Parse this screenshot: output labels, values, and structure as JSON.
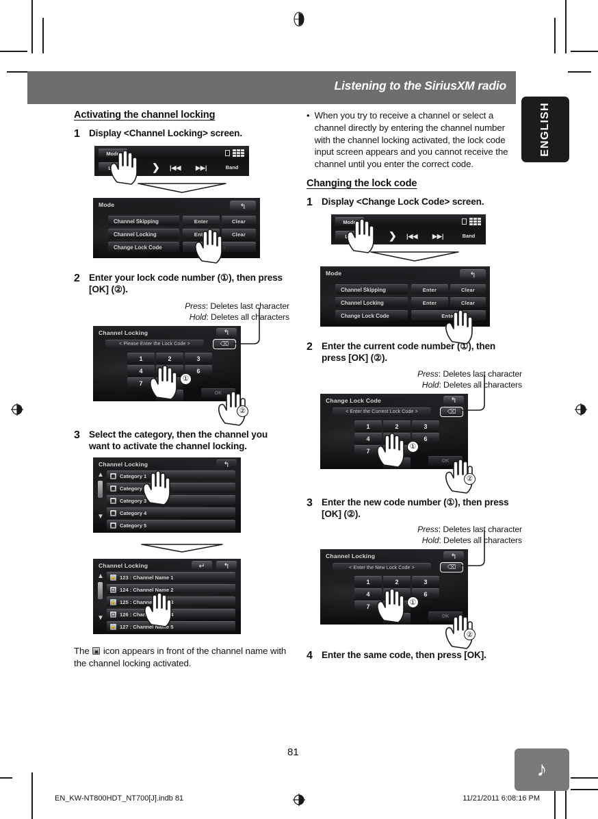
{
  "header": {
    "title": "Listening to the SiriusXM radio",
    "lang_tab": "ENGLISH",
    "note_icon": "music-note-icon"
  },
  "page": {
    "number": "81",
    "footer_left": "EN_KW-NT800HDT_NT700[J].indb   81",
    "footer_right": "11/21/2011   6:08:16 PM"
  },
  "left_column": {
    "section_heading": "Activating the channel locking",
    "step1": {
      "num": "1",
      "text": "Display <Channel Locking> screen."
    },
    "toolbar_screen": {
      "mode": "Mode",
      "list": "List",
      "next": "❯",
      "prev_track": "|◀◀",
      "next_track": "▶▶|",
      "band": "Band"
    },
    "mode_screen": {
      "title": "Mode",
      "rows": [
        {
          "label": "Channel Skipping",
          "enter": "Enter",
          "clear": "Clear"
        },
        {
          "label": "Channel Locking",
          "enter": "Enter",
          "clear": "Clear"
        },
        {
          "label": "Change Lock Code",
          "enter": "Enter",
          "clear": ""
        }
      ],
      "back_icon": "back-arrow-icon"
    },
    "step2": {
      "num": "2",
      "text_before": "Enter your lock code number (",
      "marker1": "①",
      "text_mid": "), then press [OK] (",
      "marker2": "②",
      "text_after": ")."
    },
    "press_label": "Press",
    "press_desc": ": Deletes last character",
    "hold_label": "Hold",
    "hold_desc": ": Deletes all characters",
    "keypad_screen": {
      "title": "Channel Locking",
      "prompt": "< Please Enter the Lock Code >",
      "keys": [
        "1",
        "2",
        "3",
        "4",
        "5",
        "6",
        "7",
        "8",
        "0"
      ],
      "ok": "OK",
      "delete_icon": "backspace-icon",
      "back_icon": "back-arrow-icon",
      "marker1": "①",
      "marker2": "②"
    },
    "step3": {
      "num": "3",
      "text": "Select the category, then the channel you want to activate the channel locking."
    },
    "category_screen": {
      "title": "Channel Locking",
      "rows": [
        "Category 1",
        "Category 2",
        "Category 3",
        "Category 4",
        "Category 5"
      ],
      "up_icon": "chevron-up-icon",
      "down_icon": "chevron-down-icon",
      "back_icon": "back-arrow-icon"
    },
    "channel_screen": {
      "title": "Channel Locking",
      "rows": [
        {
          "text": "123 : Channel Name 1",
          "icon": "lock-icon"
        },
        {
          "text": "124 : Channel Name 2",
          "icon": "unlock-icon"
        },
        {
          "text": "125 : Channel Name 3",
          "icon": "lock-icon"
        },
        {
          "text": "126 : Channel Name 4",
          "icon": "unlock-icon"
        },
        {
          "text": "127 : Channel Name 5",
          "icon": "lock-icon"
        }
      ],
      "up_icon": "chevron-up-icon",
      "down_icon": "chevron-down-icon",
      "return_icon": "return-arrow-icon",
      "back_icon": "back-arrow-icon"
    },
    "note_before": "The ",
    "note_after": " icon appears in front of the channel name with the channel locking activated."
  },
  "right_column": {
    "bullet": "When you try to receive a channel or select a channel directly by entering the channel number with the channel locking activated, the lock code input screen appears and you cannot receive the channel until you enter the correct code.",
    "section_heading": "Changing the lock code",
    "step1": {
      "num": "1",
      "text": "Display <Change Lock Code> screen."
    },
    "toolbar_screen": {
      "mode": "Mode",
      "list": "List",
      "next": "❯",
      "prev_track": "|◀◀",
      "next_track": "▶▶|",
      "band": "Band"
    },
    "mode_screen": {
      "title": "Mode",
      "rows": [
        {
          "label": "Channel Skipping",
          "enter": "Enter",
          "clear": "Clear"
        },
        {
          "label": "Channel Locking",
          "enter": "Enter",
          "clear": "Clear"
        },
        {
          "label": "Change Lock Code",
          "enter": "Enter",
          "clear": ""
        }
      ],
      "back_icon": "back-arrow-icon"
    },
    "step2": {
      "num": "2",
      "text_before": "Enter the current code number (",
      "marker1": "①",
      "text_mid": "), then press [OK] (",
      "marker2": "②",
      "text_after": ")."
    },
    "press_label": "Press",
    "press_desc": ": Deletes last character",
    "hold_label": "Hold",
    "hold_desc": ": Deletes all characters",
    "keypad_screen_current": {
      "title": "Change Lock Code",
      "prompt": "< Enter the Current Lock Code >",
      "keys": [
        "1",
        "2",
        "3",
        "4",
        "5",
        "6",
        "7",
        "8",
        "0"
      ],
      "ok": "OK",
      "delete_icon": "backspace-icon",
      "back_icon": "back-arrow-icon",
      "marker1": "①",
      "marker2": "②"
    },
    "step3": {
      "num": "3",
      "text_before": "Enter the new code number (",
      "marker1": "①",
      "text_mid": "), then press [OK] (",
      "marker2": "②",
      "text_after": ")."
    },
    "keypad_screen_new": {
      "title": "Channel Locking",
      "prompt": "< Enter the New Lock Code >",
      "keys": [
        "1",
        "2",
        "3",
        "4",
        "5",
        "6",
        "7",
        "8",
        "0"
      ],
      "ok": "OK",
      "delete_icon": "backspace-icon",
      "back_icon": "back-arrow-icon",
      "marker1": "①",
      "marker2": "②"
    },
    "step4": {
      "num": "4",
      "text": "Enter the same code, then press [OK]."
    }
  },
  "colors": {
    "header_band": "#6e6e6e",
    "lang_tab": "#1c1c1c",
    "note_tab": "#7a7a7a",
    "text": "#111111"
  }
}
